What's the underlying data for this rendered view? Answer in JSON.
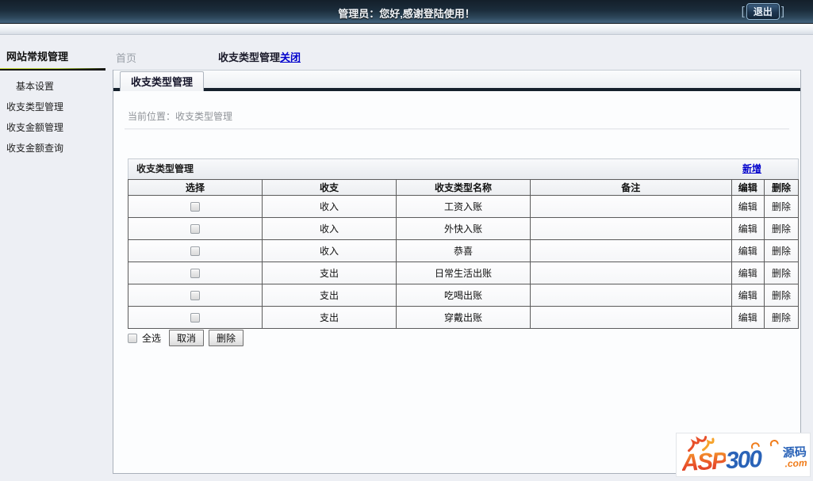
{
  "topbar": {
    "welcome": "管理员：您好,感谢登陆使用！",
    "logout_label": "退出",
    "bracket_left": "[",
    "bracket_right": "]"
  },
  "sidebar": {
    "title": "网站常规管理",
    "items": [
      {
        "label": "基本设置"
      },
      {
        "label": "收支类型管理"
      },
      {
        "label": "收支金额管理"
      },
      {
        "label": "收支金额查询"
      }
    ]
  },
  "breadcrumb": {
    "home": "首页",
    "current": "收支类型管理",
    "close_label": "关闭"
  },
  "tab": {
    "label": "收支类型管理"
  },
  "location": {
    "text": "当前位置：收支类型管理"
  },
  "section": {
    "title": "收支类型管理",
    "add_label": "新增"
  },
  "table": {
    "headers": [
      "选择",
      "收支",
      "收支类型名称",
      "备注",
      "编辑",
      "删除"
    ],
    "edit_label": "编辑",
    "delete_label": "删除",
    "rows": [
      {
        "type": "收入",
        "name": "工资入账",
        "note": ""
      },
      {
        "type": "收入",
        "name": "外快入账",
        "note": ""
      },
      {
        "type": "收入",
        "name": "恭喜",
        "note": ""
      },
      {
        "type": "支出",
        "name": "日常生活出账",
        "note": ""
      },
      {
        "type": "支出",
        "name": "吃喝出账",
        "note": ""
      },
      {
        "type": "支出",
        "name": "穿戴出账",
        "note": ""
      }
    ]
  },
  "footer_controls": {
    "select_all_label": "全选",
    "cancel_label": "取消",
    "delete_label": "删除"
  },
  "watermark": {
    "brand_asp": "ASP",
    "brand_300": "300",
    "brand_cn": "源码",
    "brand_com": ".com"
  },
  "colors": {
    "topbar_dark": "#141f2a",
    "topbar_light": "#45647e",
    "accent_green": "#c6d92f",
    "link_blue": "#0000cc",
    "tab_underline": "#16212c"
  }
}
